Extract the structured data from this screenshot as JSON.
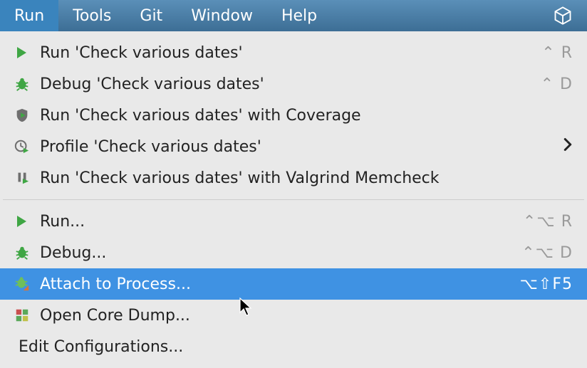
{
  "menubar": {
    "items": [
      "Run",
      "Tools",
      "Git",
      "Window",
      "Help"
    ],
    "active_index": 0
  },
  "menu": {
    "group1": [
      {
        "icon": "play",
        "label": "Run 'Check various dates'",
        "shortcut": "⌃ R",
        "submenu": false
      },
      {
        "icon": "bug",
        "label": "Debug 'Check various dates'",
        "shortcut": "⌃ D",
        "submenu": false
      },
      {
        "icon": "coverage",
        "label": "Run 'Check various dates' with Coverage",
        "shortcut": "",
        "submenu": false
      },
      {
        "icon": "profile",
        "label": "Profile 'Check various dates'",
        "shortcut": "",
        "submenu": true
      },
      {
        "icon": "valgrind",
        "label": "Run 'Check various dates' with Valgrind Memcheck",
        "shortcut": "",
        "submenu": false
      }
    ],
    "group2": [
      {
        "icon": "play",
        "label": "Run...",
        "shortcut": "⌃⌥ R",
        "submenu": false,
        "selected": false
      },
      {
        "icon": "bug",
        "label": "Debug...",
        "shortcut": "⌃⌥ D",
        "submenu": false,
        "selected": false
      },
      {
        "icon": "attach",
        "label": "Attach to Process...",
        "shortcut": "⌥⇧F5",
        "submenu": false,
        "selected": true
      },
      {
        "icon": "coredump",
        "label": "Open Core Dump...",
        "shortcut": "",
        "submenu": false,
        "selected": false
      },
      {
        "icon": "",
        "label": "Edit Configurations...",
        "shortcut": "",
        "submenu": false,
        "selected": false
      }
    ]
  }
}
